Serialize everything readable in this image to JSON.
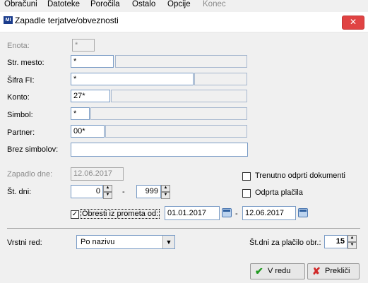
{
  "menu": {
    "items": [
      "Obračuni",
      "Datoteke",
      "Poročila",
      "Ostalo",
      "Opcije",
      "Konec"
    ]
  },
  "window": {
    "title": "Zapadle terjatve/obveznosti",
    "close_icon": "close-icon"
  },
  "fields": {
    "enota": {
      "label": "Enota:",
      "value": "*"
    },
    "str_mesto": {
      "label": "Str. mesto:",
      "value": "*"
    },
    "sifra_fi": {
      "label": "Šifra FI:",
      "value": "*"
    },
    "konto": {
      "label": "Konto:",
      "value": "27*"
    },
    "simbol": {
      "label": "Simbol:",
      "value": "*"
    },
    "partner": {
      "label": "Partner:",
      "value": "00*"
    },
    "brez_simbolov": {
      "label": "Brez simbolov:",
      "value": ""
    },
    "zapadlo_dne": {
      "label": "Zapadlo dne:",
      "value": "12.06.2017"
    },
    "st_dni": {
      "label": "Št. dni:",
      "from": "0",
      "to": "999",
      "sep": "-"
    }
  },
  "checks": {
    "trenutno": {
      "label": "Trenutno odprti dokumenti",
      "checked": false
    },
    "odprta": {
      "label": "Odprta plačila",
      "checked": false
    },
    "obresti": {
      "label": "Obresti iz prometa od:",
      "checked": true,
      "from": "01.01.2017",
      "to": "12.06.2017",
      "sep": "-"
    }
  },
  "bottom": {
    "vrstni_red_label": "Vrstni red:",
    "vrstni_red_value": "Po nazivu",
    "st_dni_placilo_label": "Št.dni za plačilo obr.:",
    "st_dni_placilo_value": "15"
  },
  "buttons": {
    "ok": "V redu",
    "cancel": "Prekliči"
  }
}
